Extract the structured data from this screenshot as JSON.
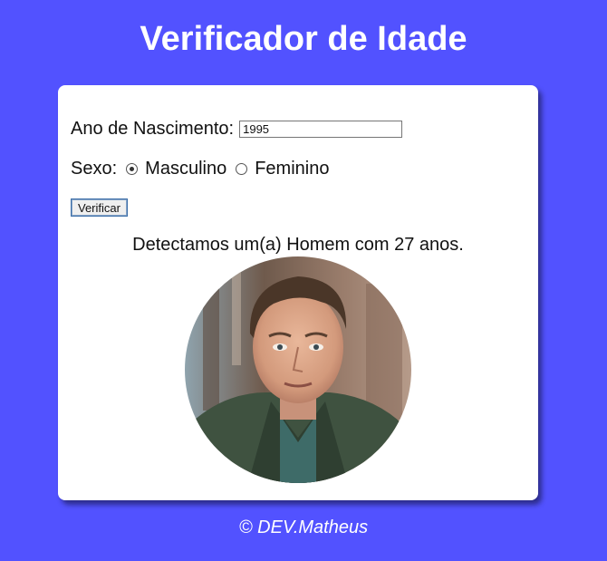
{
  "header": {
    "title": "Verificador de Idade"
  },
  "form": {
    "birth_year_label": "Ano de Nascimento:",
    "birth_year_value": "1995",
    "sex_label": "Sexo:",
    "options": [
      {
        "label": "Masculino",
        "selected": true
      },
      {
        "label": "Feminino",
        "selected": false
      }
    ],
    "verify_button_label": "Verificar"
  },
  "result": {
    "text": "Detectamos um(a) Homem com 27 anos.",
    "photo_description": "portrait photo of a man in a green jacket"
  },
  "footer": {
    "text": "© DEV.Matheus"
  },
  "colors": {
    "background": "#5252ff",
    "card": "#ffffff",
    "title_text": "#ffffff"
  }
}
